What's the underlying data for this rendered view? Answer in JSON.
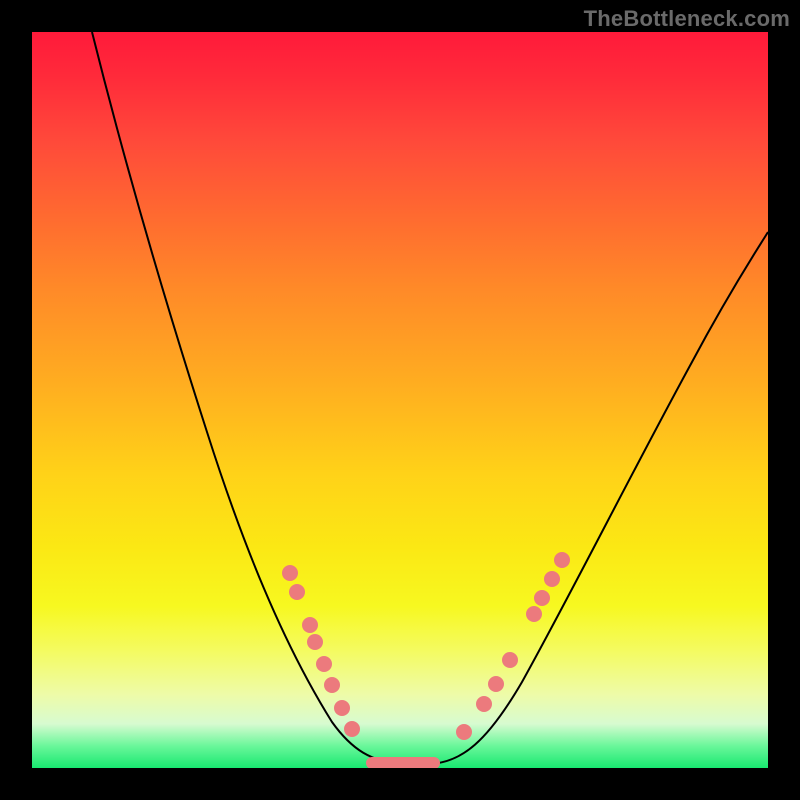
{
  "watermark": "TheBottleneck.com",
  "colors": {
    "dot": "#ec7a7d",
    "curve": "#000000",
    "frame_bg": "#000000"
  },
  "chart_data": {
    "type": "line",
    "title": "",
    "xlabel": "",
    "ylabel": "",
    "xlim": [
      0,
      100
    ],
    "ylim": [
      0,
      100
    ],
    "grid": false,
    "legend": false,
    "note": "V-shaped bottleneck curve over rainbow gradient. X is component balance position (0–100), Y is bottleneck severity (0 = optimal/green, 100 = worst/red). Values estimated from pixels; no axis ticks present.",
    "series": [
      {
        "name": "bottleneck_curve",
        "x": [
          8,
          12,
          16,
          20,
          24,
          28,
          32,
          35,
          38,
          41,
          43,
          45,
          47,
          49,
          51,
          53,
          56,
          59,
          62,
          65,
          68,
          72,
          76,
          80,
          84,
          88,
          92,
          96,
          100
        ],
        "y": [
          100,
          92,
          83,
          74,
          64,
          54,
          44,
          35,
          27,
          19,
          13,
          8,
          4,
          1,
          0,
          0,
          2,
          6,
          11,
          17,
          24,
          32,
          40,
          48,
          55,
          61,
          66,
          70,
          73
        ]
      }
    ],
    "markers": {
      "name": "highlighted_points",
      "note": "Pink dots along the curve near the valley and a flat pink segment at the minimum.",
      "left_cluster_y_approx": [
        27,
        24,
        19,
        17,
        14,
        11,
        8,
        6
      ],
      "right_cluster_y_approx": [
        6,
        10,
        13,
        17,
        24,
        27,
        30,
        32
      ],
      "flat_segment_x_range": [
        47,
        54
      ],
      "flat_segment_y": 0
    }
  }
}
